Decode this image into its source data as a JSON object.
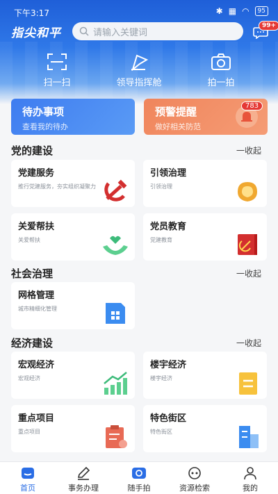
{
  "status": {
    "time": "下午3:17",
    "battery": "95"
  },
  "header": {
    "logo": "指尖和平",
    "search_placeholder": "请输入关键词",
    "msg_badge": "99+"
  },
  "quick_actions": [
    {
      "label": "扫一扫",
      "icon": "scan-icon"
    },
    {
      "label": "领导指挥舱",
      "icon": "flag-icon"
    },
    {
      "label": "拍一拍",
      "icon": "camera-icon"
    }
  ],
  "todo": {
    "title": "待办事项",
    "subtitle": "查看我的待办"
  },
  "warning": {
    "title": "预警提醒",
    "subtitle": "做好相关防范",
    "badge": "783"
  },
  "sections": [
    {
      "title": "党的建设",
      "collapse": "一收起",
      "tiles": [
        {
          "title": "党建服务",
          "subtitle": "推行党建服务，夯实组织凝聚力",
          "icon": "hammer-sickle-icon"
        },
        {
          "title": "引领治理",
          "subtitle": "引领治理",
          "icon": "helmet-icon"
        },
        {
          "title": "关爱帮扶",
          "subtitle": "关爱帮扶",
          "icon": "hands-heart-icon"
        },
        {
          "title": "党员教育",
          "subtitle": "党建教育",
          "icon": "party-book-icon"
        }
      ]
    },
    {
      "title": "社会治理",
      "collapse": "一收起",
      "tiles": [
        {
          "title": "网格管理",
          "subtitle": "城市精细化管理",
          "icon": "grid-doc-icon"
        }
      ]
    },
    {
      "title": "经济建设",
      "collapse": "一收起",
      "tiles": [
        {
          "title": "宏观经济",
          "subtitle": "宏观经济",
          "icon": "growth-chart-icon"
        },
        {
          "title": "楼宇经济",
          "subtitle": "楼宇经济",
          "icon": "document-icon"
        },
        {
          "title": "重点项目",
          "subtitle": "重点项目",
          "icon": "clipboard-icon"
        },
        {
          "title": "特色街区",
          "subtitle": "特色街区",
          "icon": "building-icon"
        }
      ]
    }
  ],
  "tabs": [
    {
      "label": "首页",
      "icon": "home-icon",
      "active": true
    },
    {
      "label": "事务办理",
      "icon": "pen-icon",
      "active": false
    },
    {
      "label": "随手拍",
      "icon": "camera-icon",
      "active": false
    },
    {
      "label": "资源检索",
      "icon": "search-eye-icon",
      "active": false
    },
    {
      "label": "我的",
      "icon": "user-icon",
      "active": false
    }
  ],
  "colors": {
    "primary": "#2a6de5",
    "todo": "#3e7cf0",
    "warning": "#f0855c",
    "badge": "#e53935"
  }
}
